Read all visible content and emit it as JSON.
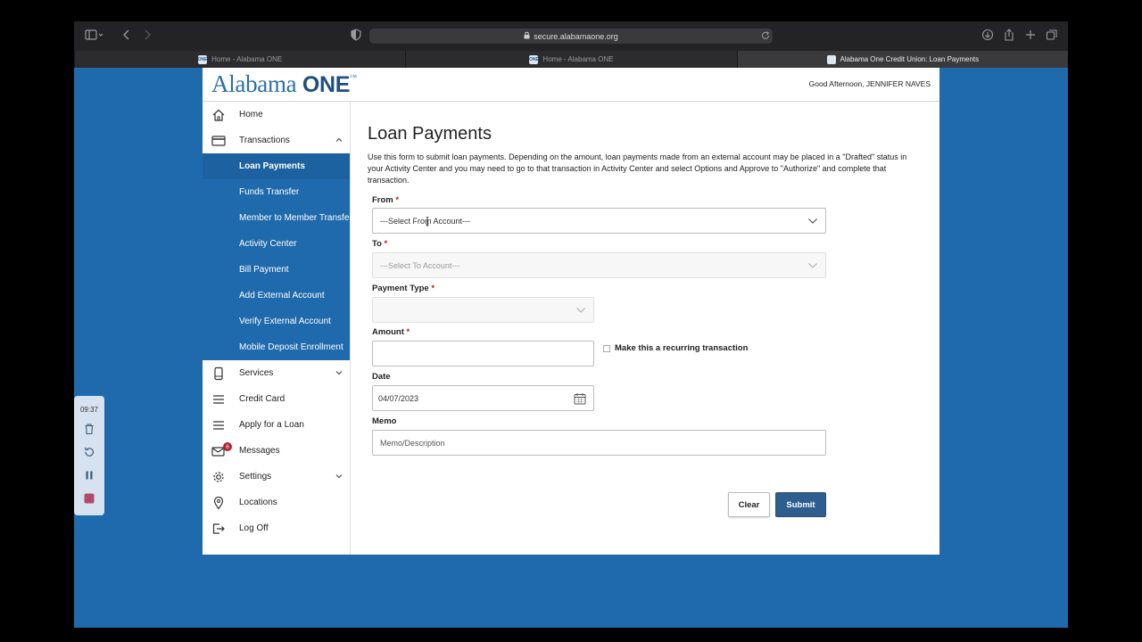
{
  "browser": {
    "url": "secure.alabamaone.org",
    "tabs": [
      {
        "favicon": "ONE",
        "title": "Home - Alabama ONE",
        "active": false
      },
      {
        "favicon": "ONE",
        "title": "Home - Alabama ONE",
        "active": false
      },
      {
        "favicon": "",
        "title": "Alabama One Credit Union: Loan Payments",
        "active": true
      }
    ]
  },
  "header": {
    "logo_part1": "Alabama",
    "logo_part2": "ONE",
    "logo_tm": "™",
    "greeting": "Good Afternoon, JENNIFER NAVES"
  },
  "sidebar": {
    "items": [
      {
        "label": "Home",
        "icon": "home-icon"
      },
      {
        "label": "Transactions",
        "icon": "credit-card-icon",
        "expanded": true
      },
      {
        "label": "Services",
        "icon": "phone-icon"
      },
      {
        "label": "Credit Card",
        "icon": "menu-icon"
      },
      {
        "label": "Apply for a Loan",
        "icon": "menu-icon"
      },
      {
        "label": "Messages",
        "icon": "envelope-icon",
        "badge": "6"
      },
      {
        "label": "Settings",
        "icon": "gear-icon"
      },
      {
        "label": "Locations",
        "icon": "map-pin-icon"
      },
      {
        "label": "Log Off",
        "icon": "logout-icon"
      }
    ],
    "sub_items": [
      {
        "label": "Loan Payments",
        "active": true
      },
      {
        "label": "Funds Transfer"
      },
      {
        "label": "Member to Member Transfer"
      },
      {
        "label": "Activity Center"
      },
      {
        "label": "Bill Payment"
      },
      {
        "label": "Add External Account"
      },
      {
        "label": "Verify External Account"
      },
      {
        "label": "Mobile Deposit Enrollment"
      }
    ]
  },
  "form": {
    "title": "Loan Payments",
    "description": "Use this form to submit loan payments. Depending on the amount, loan payments made from an external account may be placed in a \"Drafted\" status in your Activity Center and you may need to go to that transaction in Activity Center and select Options and Approve to \"Authorize\" and complete that transaction.",
    "from_label": "From",
    "from_value": "---Select From Account---",
    "to_label": "To",
    "to_value": "---Select To Account---",
    "payment_type_label": "Payment Type",
    "payment_type_value": "",
    "amount_label": "Amount",
    "amount_value": "",
    "recurring_label": "Make this a recurring transaction",
    "date_label": "Date",
    "date_value": "04/07/2023",
    "memo_label": "Memo",
    "memo_placeholder": "Memo/Description",
    "required_mark": "*",
    "clear_label": "Clear",
    "submit_label": "Submit"
  },
  "recorder": {
    "time": "09:37"
  },
  "colors": {
    "brand_blue": "#1f6aac",
    "submit_blue": "#2d5e8e",
    "required_red": "#b3242b"
  }
}
